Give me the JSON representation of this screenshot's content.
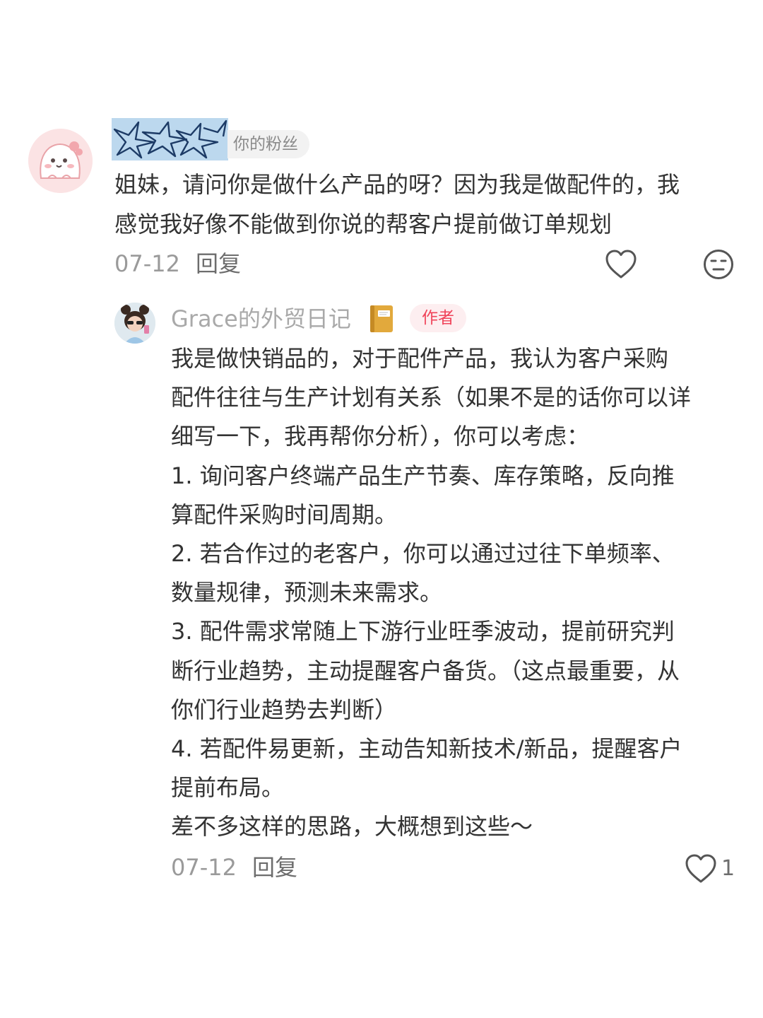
{
  "comment": {
    "fan_badge": "你的粉丝",
    "text": "姐妹，请问你是做什么产品的呀？因为我是做配件的，我\n感觉我好像不能做到你说的帮客户提前做订单规划",
    "date": "07-12",
    "reply_label": "回复",
    "icons": {
      "avatar": "cartoon-avatar",
      "like": "heart-outline-icon",
      "emoji": "expressionless-face-icon"
    }
  },
  "reply": {
    "author_name": "Grace的外贸日记",
    "author_badge": "作者",
    "lines": [
      "我是做快销品的，对于配件产品，我认为客户采购",
      "配件往往与生产计划有关系（如果不是的话你可以详",
      "细写一下，我再帮你分析），你可以考虑：",
      "1. 询问客户终端产品生产节奏、库存策略，反向推",
      "算配件采购时间周期。",
      "2. 若合作过的老客户，你可以通过过往下单频率、",
      "数量规律，预测未来需求。",
      "3. 配件需求常随上下游行业旺季波动，提前研究判",
      "断行业趋势，主动提醒客户备货。（这点最重要，从",
      "你们行业趋势去判断）",
      "4. 若配件易更新，主动告知新技术/新品，提醒客户",
      "提前布局。",
      "差不多这样的思路，大概想到这些～"
    ],
    "date": "07-12",
    "reply_label": "回复",
    "like_count": "1",
    "icons": {
      "avatar": "girl-avatar",
      "name_emoji": "notebook-icon",
      "like": "heart-outline-icon"
    }
  }
}
